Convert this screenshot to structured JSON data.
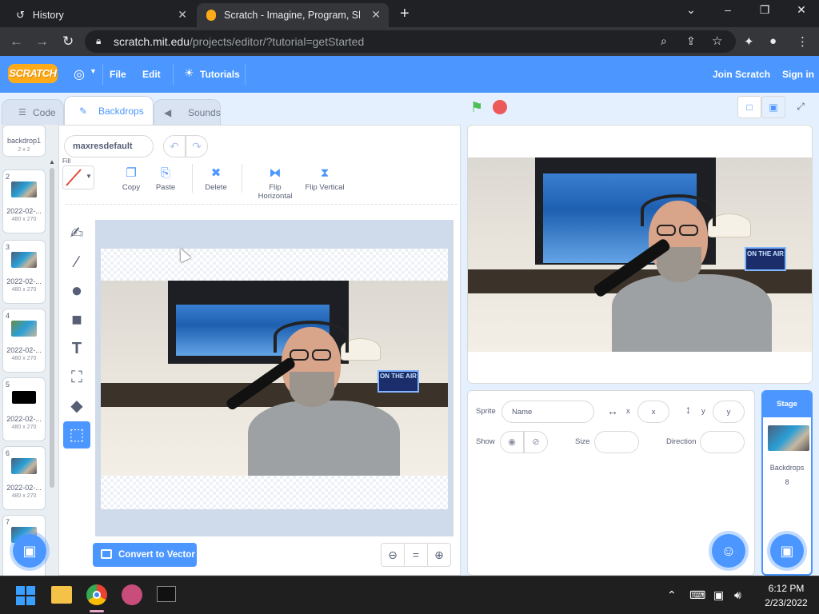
{
  "browser": {
    "tabs": [
      {
        "title": "History"
      },
      {
        "title": "Scratch - Imagine, Program, Shar"
      }
    ],
    "url_domain": "scratch.mit.edu",
    "url_path": "/projects/editor/?tutorial=getStarted"
  },
  "menubar": {
    "logo": "SCRATCH",
    "file": "File",
    "edit": "Edit",
    "tutorials": "Tutorials",
    "join": "Join Scratch",
    "signin": "Sign in"
  },
  "editor_tabs": {
    "code": "Code",
    "backdrops": "Backdrops",
    "sounds": "Sounds"
  },
  "backdrops": [
    {
      "num": "",
      "name": "backdrop1",
      "size": "2 x 2"
    },
    {
      "num": "2",
      "name": "2022-02-...",
      "size": "480 x 270"
    },
    {
      "num": "3",
      "name": "2022-02-...",
      "size": "480 x 270"
    },
    {
      "num": "4",
      "name": "2022-02-...",
      "size": "480 x 270"
    },
    {
      "num": "5",
      "name": "2022-02-...",
      "size": "480 x 270"
    },
    {
      "num": "6",
      "name": "2022-02-...",
      "size": "480 x 270"
    },
    {
      "num": "7",
      "name": "",
      "size": ""
    }
  ],
  "paint": {
    "costume_name": "maxresdefault",
    "fill_label": "Fill",
    "actions": {
      "copy": "Copy",
      "paste": "Paste",
      "delete": "Delete",
      "flip_h": "Flip Horizontal",
      "flip_v": "Flip Vertical"
    },
    "convert": "Convert to Vector",
    "sign_text": "ON THE AIR"
  },
  "sprite_info": {
    "sprite_label": "Sprite",
    "name_placeholder": "Name",
    "x_label": "x",
    "x_placeholder": "x",
    "y_label": "y",
    "y_placeholder": "y",
    "show_label": "Show",
    "size_label": "Size",
    "direction_label": "Direction"
  },
  "stage_panel": {
    "title": "Stage",
    "backdrops_label": "Backdrops",
    "backdrops_count": "8"
  },
  "taskbar": {
    "time": "6:12 PM",
    "date": "2/23/2022"
  },
  "colors": {
    "scratch_blue": "#4c97ff",
    "scratch_purple": "#855cd6",
    "logo_orange": "#ffab19",
    "green_flag": "#4cbf56",
    "stop_red": "#ec5959"
  }
}
